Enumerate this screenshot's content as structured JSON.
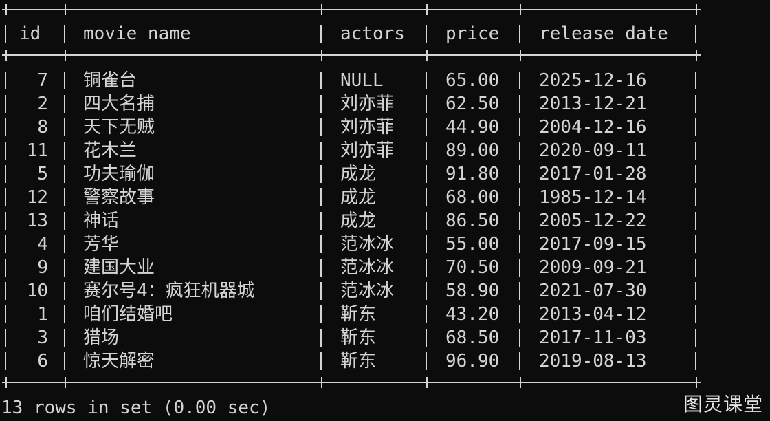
{
  "table": {
    "columns": [
      "id",
      "movie_name",
      "actors",
      "price",
      "release_date"
    ],
    "rows": [
      {
        "id": "7",
        "movie_name": "铜雀台",
        "actors": "NULL",
        "price": "65.00",
        "release_date": "2025-12-16"
      },
      {
        "id": "2",
        "movie_name": "四大名捕",
        "actors": "刘亦菲",
        "price": "62.50",
        "release_date": "2013-12-21"
      },
      {
        "id": "8",
        "movie_name": "天下无贼",
        "actors": "刘亦菲",
        "price": "44.90",
        "release_date": "2004-12-16"
      },
      {
        "id": "11",
        "movie_name": "花木兰",
        "actors": "刘亦菲",
        "price": "89.00",
        "release_date": "2020-09-11"
      },
      {
        "id": "5",
        "movie_name": "功夫瑜伽",
        "actors": "成龙",
        "price": "91.80",
        "release_date": "2017-01-28"
      },
      {
        "id": "12",
        "movie_name": "警察故事",
        "actors": "成龙",
        "price": "68.00",
        "release_date": "1985-12-14"
      },
      {
        "id": "13",
        "movie_name": "神话",
        "actors": "成龙",
        "price": "86.50",
        "release_date": "2005-12-22"
      },
      {
        "id": "4",
        "movie_name": "芳华",
        "actors": "范冰冰",
        "price": "55.00",
        "release_date": "2017-09-15"
      },
      {
        "id": "9",
        "movie_name": "建国大业",
        "actors": "范冰冰",
        "price": "70.50",
        "release_date": "2009-09-21"
      },
      {
        "id": "10",
        "movie_name": "赛尔号4：疯狂机器城",
        "actors": "范冰冰",
        "price": "58.90",
        "release_date": "2021-07-30"
      },
      {
        "id": "1",
        "movie_name": "咱们结婚吧",
        "actors": "靳东",
        "price": "43.20",
        "release_date": "2013-04-12"
      },
      {
        "id": "3",
        "movie_name": "猎场",
        "actors": "靳东",
        "price": "68.50",
        "release_date": "2017-11-03"
      },
      {
        "id": "6",
        "movie_name": "惊天解密",
        "actors": "靳东",
        "price": "96.90",
        "release_date": "2019-08-13"
      }
    ]
  },
  "status_text": "13 rows in set (0.00 sec)",
  "watermark": "图灵课堂",
  "colors": {
    "background": "#0c0c0c",
    "foreground": "#d4d4d4"
  }
}
